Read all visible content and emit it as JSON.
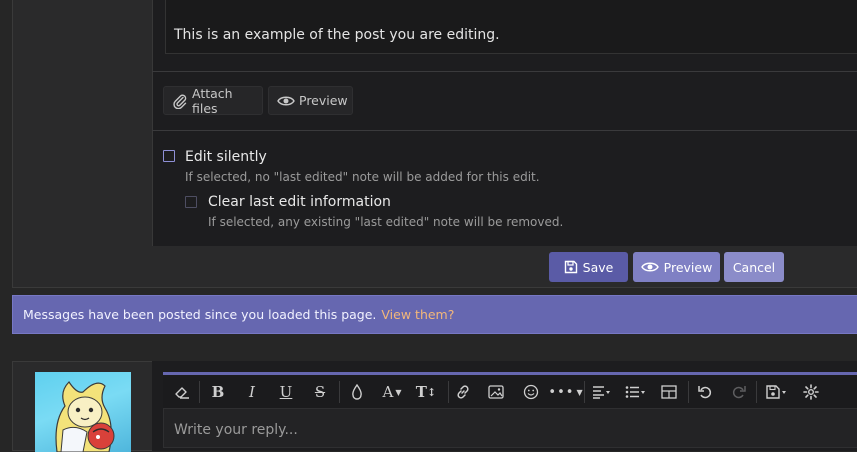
{
  "editor": {
    "body_text": "This is an example of the post you are editing.",
    "attach_label": "Attach files",
    "preview_label": "Preview"
  },
  "options": {
    "edit_silently": {
      "label": "Edit silently",
      "hint": "If selected, no \"last edited\" note will be added for this edit.",
      "checked": false
    },
    "clear_last_edit": {
      "label": "Clear last edit information",
      "hint": "If selected, any existing \"last edited\" note will be removed.",
      "checked": false
    }
  },
  "actions": {
    "save_label": "Save",
    "preview_label": "Preview",
    "cancel_label": "Cancel"
  },
  "notice": {
    "text": "Messages have been posted since you loaded this page.",
    "link": "View them?"
  },
  "reply": {
    "placeholder": "Write your reply...",
    "toolbar_icons": [
      "eraser-icon",
      "bold-icon",
      "italic-icon",
      "underline-icon",
      "strikethrough-icon",
      "color-drop-icon",
      "font-family-icon",
      "font-size-icon",
      "link-icon",
      "image-icon",
      "smiley-icon",
      "more-icon",
      "align-icon",
      "list-icon",
      "table-icon",
      "undo-icon",
      "redo-icon",
      "drafts-icon",
      "settings-icon"
    ]
  },
  "colors": {
    "accent": "#6667b0",
    "accent_light": "#8f90d6",
    "link": "#f3b77a",
    "panel": "#1d1d1f",
    "background": "#262626"
  }
}
